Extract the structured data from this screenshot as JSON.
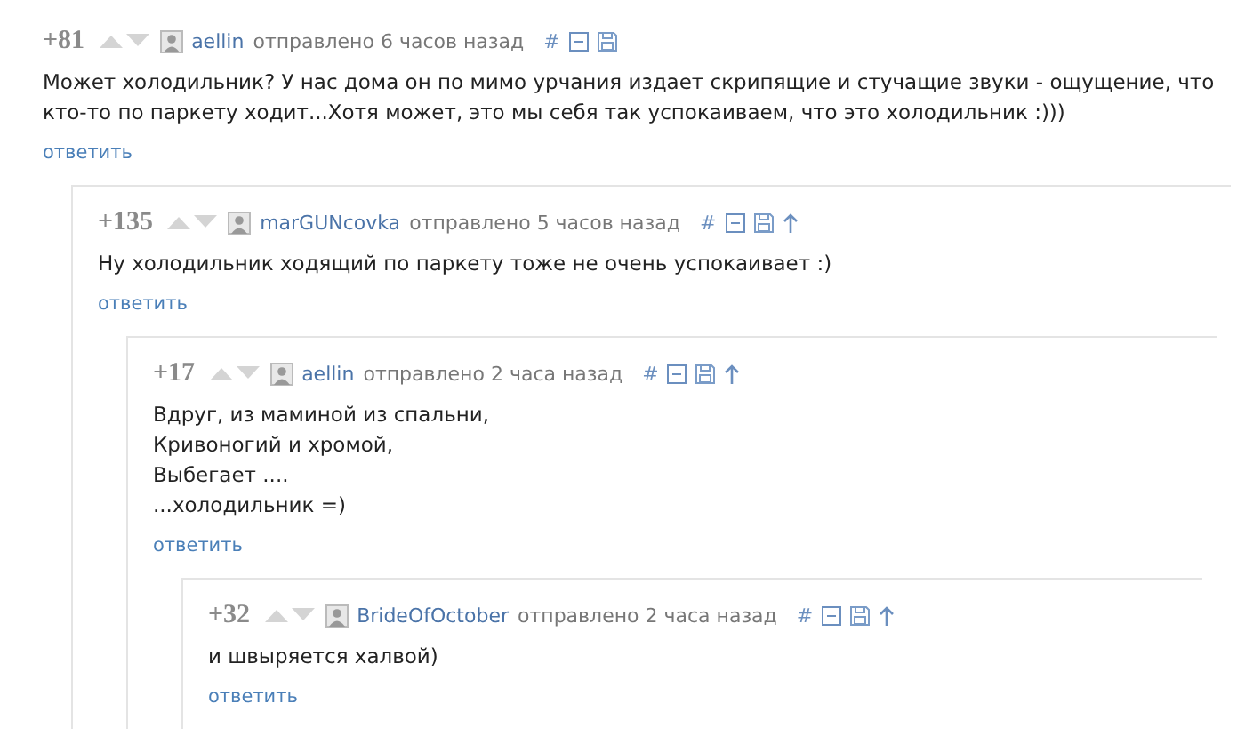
{
  "comments": [
    {
      "score": "+81",
      "author": "aellin",
      "posted": "отправлено 6 часов назад",
      "anchor": "#",
      "has_parent_link": false,
      "body": [
        "Может холодильник? У нас дома он по мимо урчания издает скрипящие и стучащие звуки - ощущение, что кто-то по паркету ходит...Хотя может, это мы себя так успокаиваем, что это холодильник :)))"
      ],
      "reply": "ответить",
      "children": [
        {
          "score": "+135",
          "author": "marGUNcovka",
          "posted": "отправлено 5 часов назад",
          "anchor": "#",
          "has_parent_link": true,
          "body": [
            "Ну холодильник ходящий по паркету тоже не очень успокаивает :)"
          ],
          "reply": "ответить",
          "children": [
            {
              "score": "+17",
              "author": "aellin",
              "posted": "отправлено 2 часа назад",
              "anchor": "#",
              "has_parent_link": true,
              "body": [
                "Вдруг, из маминой из спальни,",
                "Кривоногий и хромой,",
                "Выбегает ....",
                "...холодильник =)"
              ],
              "reply": "ответить",
              "children": [
                {
                  "score": "+32",
                  "author": "BrideOfOctober",
                  "posted": "отправлено 2 часа назад",
                  "anchor": "#",
                  "has_parent_link": true,
                  "body": [
                    "и швыряется халвой)"
                  ],
                  "reply": "ответить"
                }
              ]
            }
          ]
        }
      ]
    }
  ]
}
